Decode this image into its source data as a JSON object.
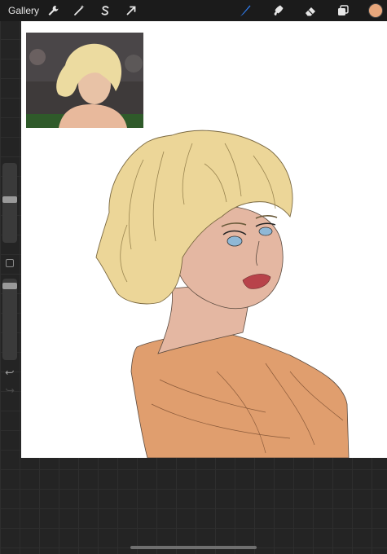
{
  "toolbar": {
    "gallery_label": "Gallery",
    "left_tools": [
      "wrench-icon",
      "magic-wand-icon",
      "selection-s-icon",
      "transform-arrow-icon"
    ],
    "right_tools": [
      "brush-icon",
      "smudge-icon",
      "eraser-icon",
      "layers-icon"
    ],
    "active_tool": "brush-icon",
    "active_tool_color": "#2f7bea",
    "current_color": "#e8a77c"
  },
  "sidebar": {
    "brush_size": 0.45,
    "opacity": 0.05
  },
  "canvas": {
    "background": "#ffffff",
    "colors": {
      "hair": "#ecd698",
      "skin": "#e4b7a2",
      "lips": "#b8434a",
      "eyes": "#8fb8d6",
      "garment": "#e09e6e",
      "line": "#555555"
    }
  }
}
